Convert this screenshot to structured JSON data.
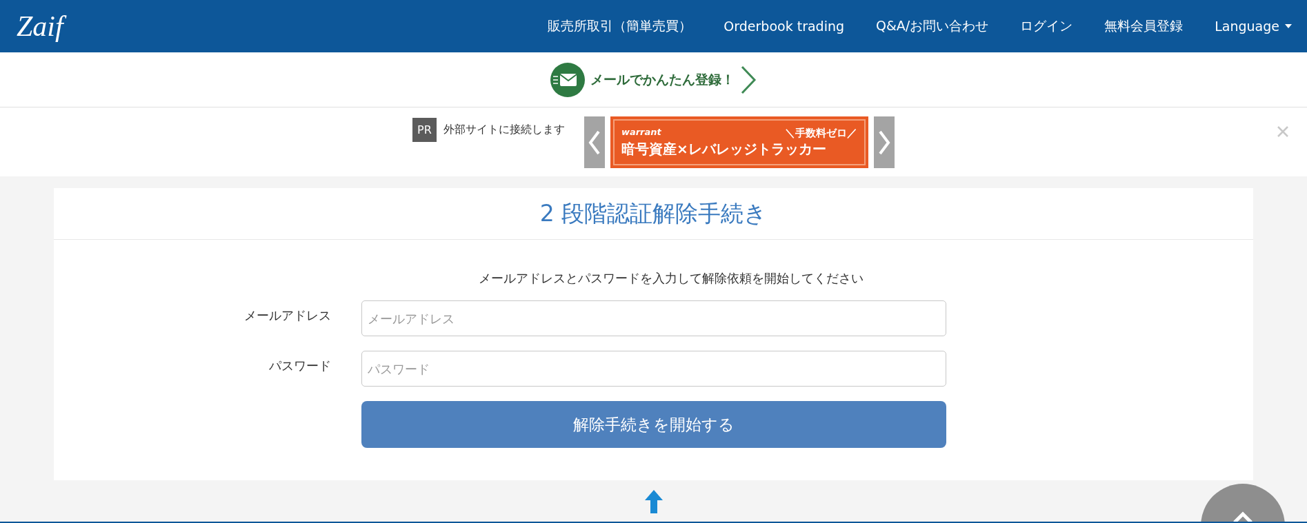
{
  "header": {
    "logo": "Zaif",
    "nav": [
      {
        "label": "販売所取引（簡単売買）",
        "dropdown": false
      },
      {
        "label": "Orderbook trading",
        "dropdown": false
      },
      {
        "label": "Q&A/お問い合わせ",
        "dropdown": false
      },
      {
        "label": "ログイン",
        "dropdown": false
      },
      {
        "label": "無料会員登録",
        "dropdown": false
      },
      {
        "label": "Language",
        "dropdown": true
      }
    ]
  },
  "signup_banner": {
    "text": "メールでかんたん登録！"
  },
  "ad": {
    "badge": "PR",
    "notice": "外部サイトに接続します",
    "brand": "warrant",
    "tagline": "＼手数料ゼロ／",
    "headline": "暗号資産×レバレッジトラッカー"
  },
  "form": {
    "title": "2 段階認証解除手続き",
    "instruction": "メールアドレスとパスワードを入力して解除依頼を開始してください",
    "fields": [
      {
        "label": "メールアドレス",
        "placeholder": "メールアドレス"
      },
      {
        "label": "パスワード",
        "placeholder": "パスワード"
      }
    ],
    "submit": "解除手続きを開始する"
  }
}
